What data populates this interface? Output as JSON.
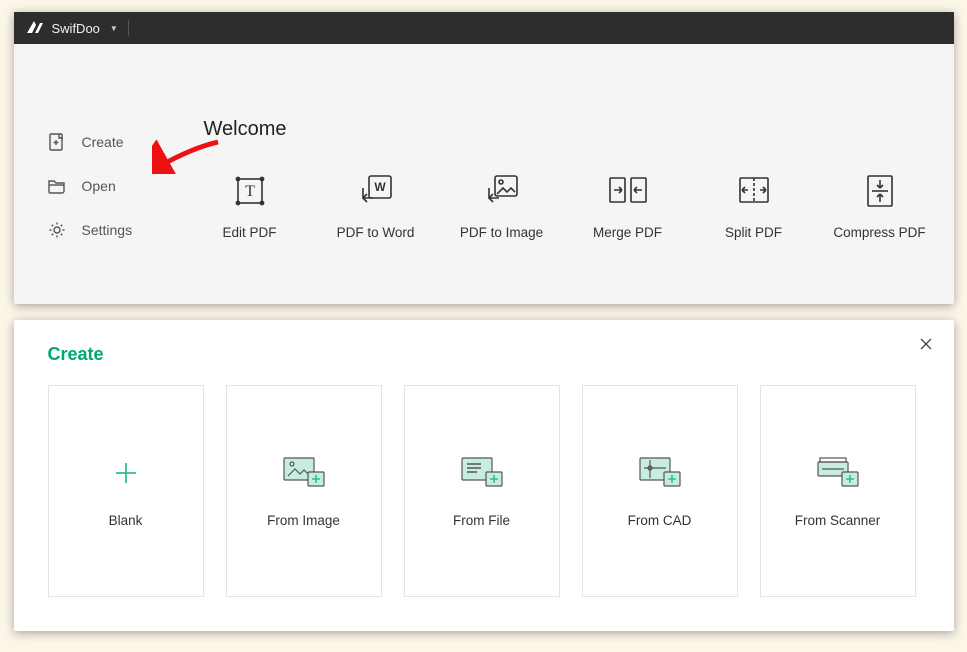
{
  "app": {
    "brand": "SwifDoo"
  },
  "sidebar": {
    "items": [
      {
        "label": "Create"
      },
      {
        "label": "Open"
      },
      {
        "label": "Settings"
      }
    ]
  },
  "main": {
    "welcome": "Welcome",
    "actions": [
      {
        "label": "Edit PDF"
      },
      {
        "label": "PDF to Word"
      },
      {
        "label": "PDF to Image"
      },
      {
        "label": "Merge PDF"
      },
      {
        "label": "Split PDF"
      },
      {
        "label": "Compress PDF"
      }
    ]
  },
  "create": {
    "title": "Create",
    "cards": [
      {
        "label": "Blank"
      },
      {
        "label": "From Image"
      },
      {
        "label": "From File"
      },
      {
        "label": "From CAD"
      },
      {
        "label": "From Scanner"
      }
    ]
  }
}
